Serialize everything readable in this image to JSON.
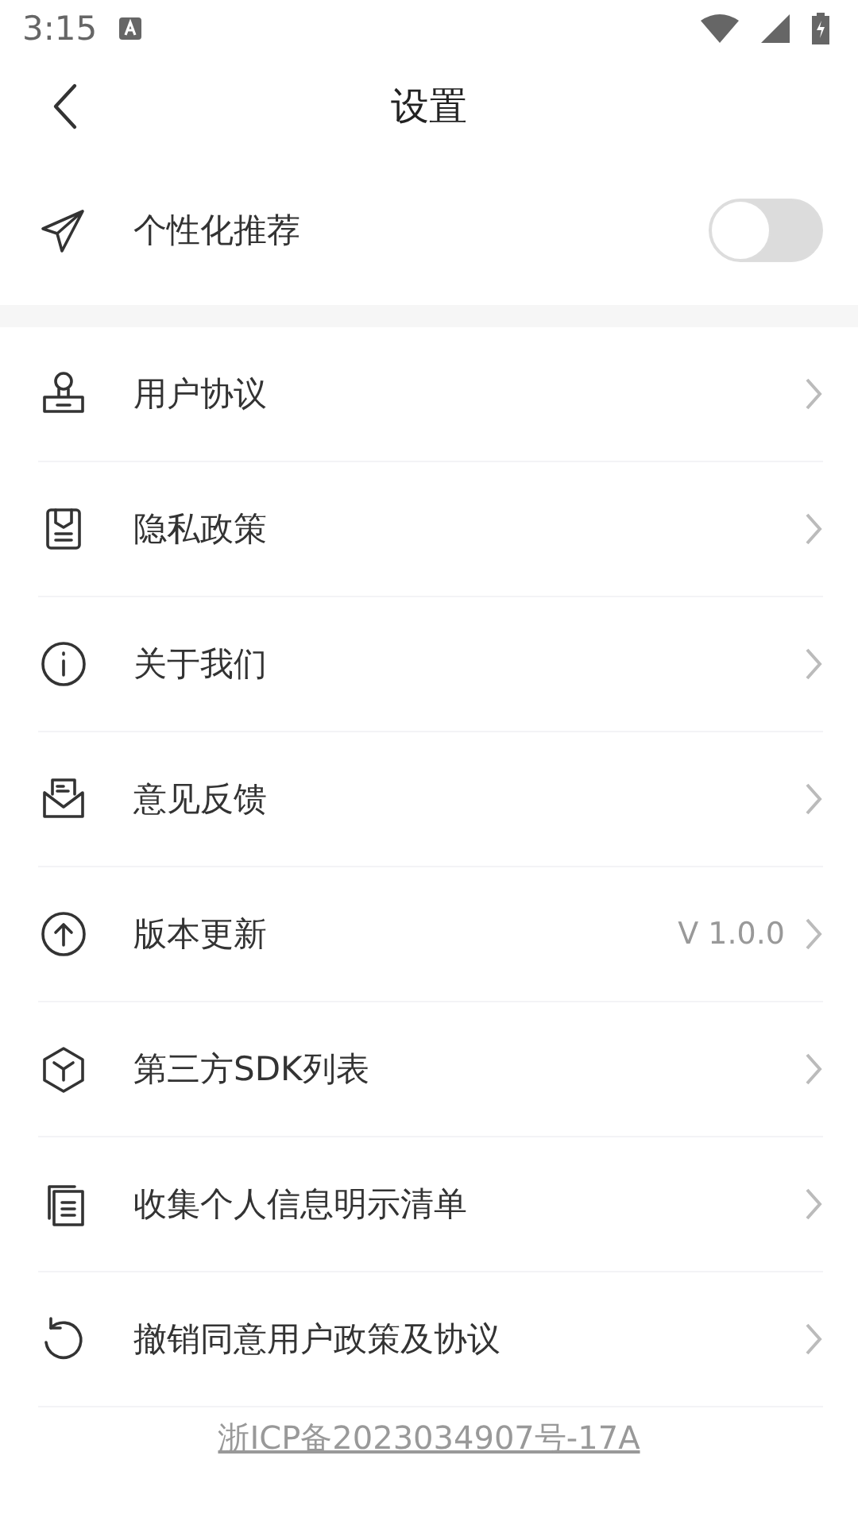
{
  "status_bar": {
    "time": "3:15"
  },
  "header": {
    "title": "设置"
  },
  "toggle_row": {
    "label": "个性化推荐",
    "on": false
  },
  "menu": [
    {
      "label": "用户协议"
    },
    {
      "label": "隐私政策"
    },
    {
      "label": "关于我们"
    },
    {
      "label": "意见反馈"
    },
    {
      "label": "版本更新",
      "value": "V 1.0.0"
    },
    {
      "label": "第三方SDK列表"
    },
    {
      "label": "收集个人信息明示清单"
    },
    {
      "label": "撤销同意用户政策及协议"
    }
  ],
  "footer": {
    "link": "浙ICP备2023034907号-17A"
  }
}
